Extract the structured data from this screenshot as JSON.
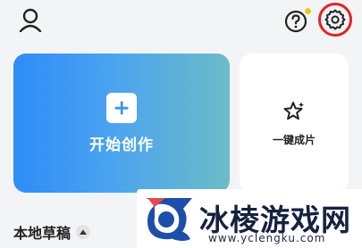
{
  "header": {
    "profile_icon": "user-icon",
    "help_icon": "help-icon",
    "settings_icon": "gear-icon",
    "has_notification": true,
    "notification_color": "#f5c518",
    "highlight_color": "#e52222"
  },
  "cards": {
    "create": {
      "label": "开始创作",
      "icon": "plus-icon"
    },
    "one_click": {
      "label": "一键成片",
      "icon": "sparkle-icon"
    }
  },
  "drafts": {
    "title": "本地草稿",
    "toggle_icon": "caret-up-icon"
  },
  "watermark": {
    "title": "冰棱游戏网",
    "url": "www.yclengku.com"
  }
}
